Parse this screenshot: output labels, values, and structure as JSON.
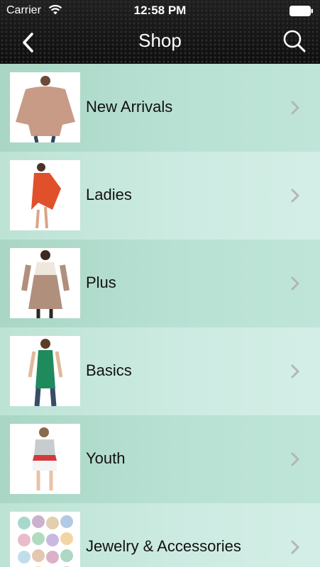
{
  "status_bar": {
    "carrier": "Carrier",
    "time": "12:58 PM",
    "wifi_icon": "wifi-icon",
    "battery_icon": "battery-icon"
  },
  "nav": {
    "title": "Shop",
    "back_icon": "chevron-left-icon",
    "search_icon": "search-icon"
  },
  "categories": [
    {
      "label": "New Arrivals",
      "thumb": "beige poncho top"
    },
    {
      "label": "Ladies",
      "thumb": "orange asymmetric dress"
    },
    {
      "label": "Plus",
      "thumb": "taupe babydoll top"
    },
    {
      "label": "Basics",
      "thumb": "green tank top"
    },
    {
      "label": "Youth",
      "thumb": "girl in white shorts"
    },
    {
      "label": "Jewelry & Accessories",
      "thumb": "beaded bracelets"
    }
  ],
  "colors": {
    "nav_background": "#1b1b1b",
    "row_dark": "#a9d6c5",
    "row_light": "#cdebe2",
    "chevron": "#b5b5b5"
  }
}
